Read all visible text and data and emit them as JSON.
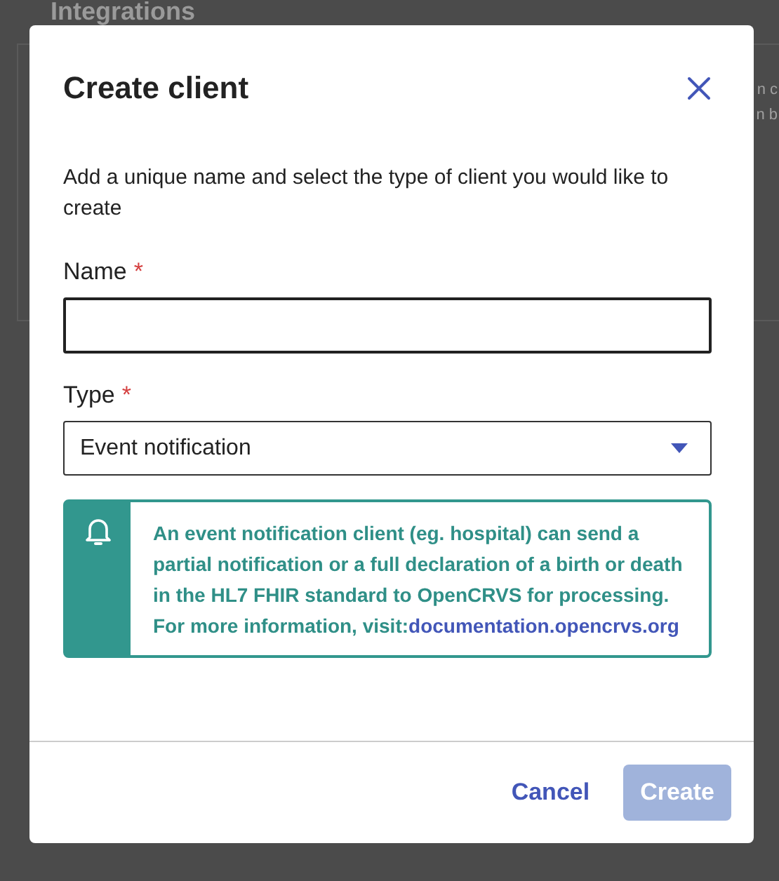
{
  "page": {
    "heading": "Integrations",
    "fragments": [
      "n c",
      "n b"
    ]
  },
  "dialog": {
    "title": "Create client",
    "description": "Add a unique name and select the type of client you would like to create",
    "fields": [
      {
        "kind": "text",
        "label": "Name",
        "required": true,
        "required_mark": "*"
      },
      {
        "kind": "select",
        "label": "Type",
        "required": true,
        "required_mark": "*",
        "value": "Event notification"
      }
    ],
    "info": {
      "text": "An event notification client (eg. hospital) can send a partial notification or a full declaration of a birth or death in the HL7 FHIR standard to OpenCRVS for processing. For more information, visit:",
      "link": "documentation.opencrvs.org"
    },
    "buttons": [
      {
        "label": "Cancel",
        "kind": "tertiary",
        "disabled": false
      },
      {
        "label": "Create",
        "kind": "primary",
        "disabled": true
      }
    ]
  }
}
